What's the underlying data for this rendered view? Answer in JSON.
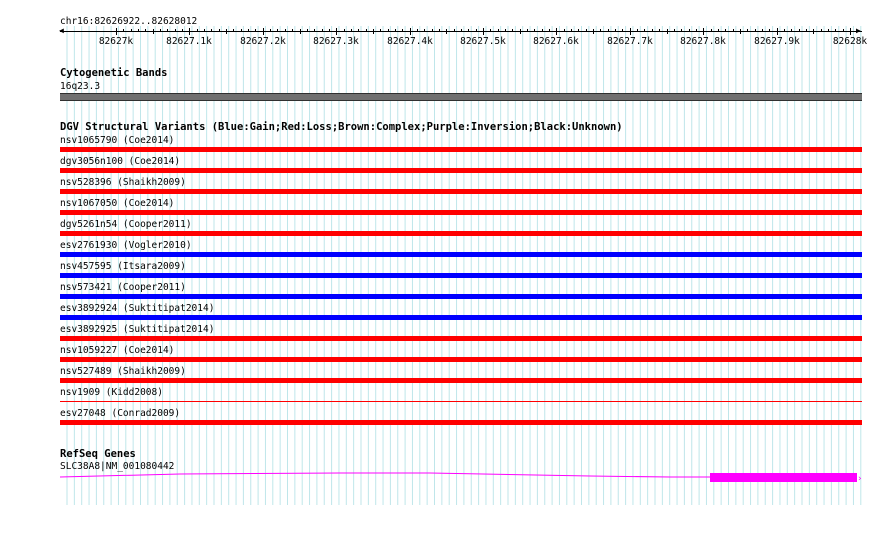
{
  "ruler": {
    "location": "chr16:82626922..82628012",
    "ticks": [
      "82627k",
      "82627.1k",
      "82627.2k",
      "82627.3k",
      "82627.4k",
      "82627.5k",
      "82627.6k",
      "82627.7k",
      "82627.8k",
      "82627.9k",
      "82628k"
    ]
  },
  "cytoband": {
    "title": "Cytogenetic Bands",
    "band": "16q23.3",
    "color": "#707070"
  },
  "dgv": {
    "title": "DGV Structural Variants (Blue:Gain;Red:Loss;Brown:Complex;Purple:Inversion;Black:Unknown)",
    "colors": {
      "gain": "#0000ff",
      "loss": "#ff0000"
    },
    "variants": [
      {
        "label": "nsv1065790 (Coe2014)",
        "type": "loss"
      },
      {
        "label": "dgv3056n100 (Coe2014)",
        "type": "loss"
      },
      {
        "label": "nsv528396 (Shaikh2009)",
        "type": "loss"
      },
      {
        "label": "nsv1067050 (Coe2014)",
        "type": "loss"
      },
      {
        "label": "dgv5261n54 (Cooper2011)",
        "type": "loss"
      },
      {
        "label": "esv2761930 (Vogler2010)",
        "type": "gain"
      },
      {
        "label": "nsv457595 (Itsara2009)",
        "type": "gain"
      },
      {
        "label": "nsv573421 (Cooper2011)",
        "type": "gain"
      },
      {
        "label": "esv3892924 (Suktitipat2014)",
        "type": "gain"
      },
      {
        "label": "esv3892925 (Suktitipat2014)",
        "type": "loss"
      },
      {
        "label": "nsv1059227 (Coe2014)",
        "type": "loss"
      },
      {
        "label": "nsv527489 (Shaikh2009)",
        "type": "loss"
      },
      {
        "label": "nsv1909 (Kidd2008)",
        "type": "thin-loss"
      },
      {
        "label": "esv27048 (Conrad2009)",
        "type": "loss"
      }
    ]
  },
  "refseq": {
    "title": "RefSeq Genes",
    "gene": "SLC38A8|NM_001080442",
    "color": "#ff00ff"
  }
}
